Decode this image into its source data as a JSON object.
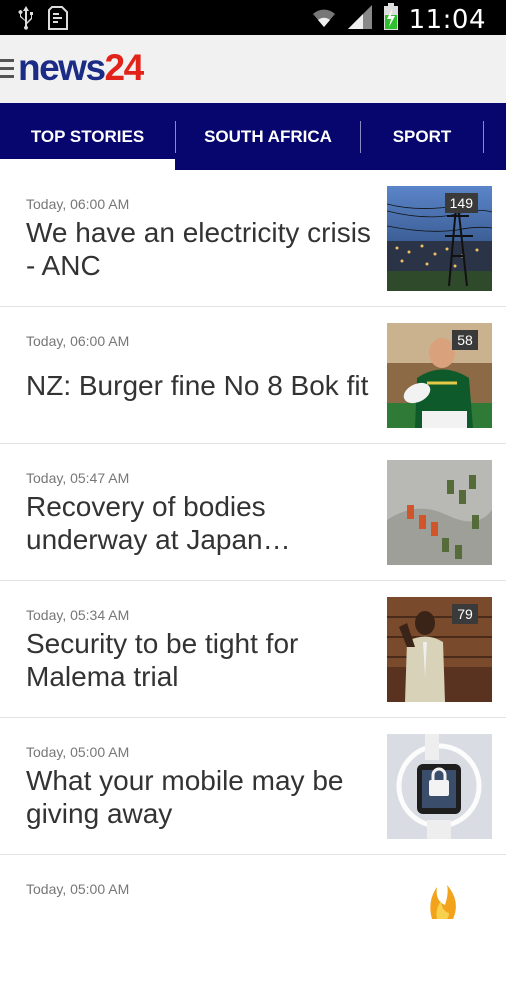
{
  "status_bar": {
    "left_icons": [
      "usb-icon",
      "sd-card-icon"
    ],
    "right_icons": [
      "wifi-icon",
      "signal-icon",
      "battery-charging-icon"
    ],
    "time": "11:04"
  },
  "app": {
    "logo_part1": "news",
    "logo_part2": "24",
    "brand_colors": {
      "news": "#1a2c86",
      "number": "#e2231a"
    }
  },
  "tabs": [
    {
      "label": "TOP STORIES",
      "selected": true
    },
    {
      "label": "SOUTH AFRICA",
      "selected": false
    },
    {
      "label": "SPORT",
      "selected": false
    }
  ],
  "articles": [
    {
      "time": "Today, 06:00 AM",
      "headline": "We have an electricity crisis - ANC",
      "comments": "149",
      "thumb": "power-lines-image"
    },
    {
      "time": "Today, 06:00 AM",
      "headline": "NZ: Burger fine No 8 Bok fit",
      "comments": "58",
      "thumb": "rugby-player-image"
    },
    {
      "time": "Today, 05:47 AM",
      "headline": "Recovery of bodies underway at Japan…",
      "comments": "",
      "thumb": "rescue-team-image"
    },
    {
      "time": "Today, 05:34 AM",
      "headline": "Security to be tight for Malema trial",
      "comments": "79",
      "thumb": "courtroom-image"
    },
    {
      "time": "Today, 05:00 AM",
      "headline": "What your mobile may be giving away",
      "comments": "",
      "thumb": "mobile-security-image"
    },
    {
      "time": "Today, 05:00 AM",
      "headline": "",
      "comments": "",
      "thumb": "flame-image"
    }
  ]
}
